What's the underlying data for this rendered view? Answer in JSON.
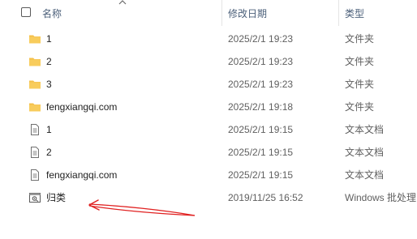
{
  "header": {
    "name_label": "名称",
    "date_label": "修改日期",
    "type_label": "类型"
  },
  "rows": [
    {
      "name": "1",
      "date": "2025/2/1 19:23",
      "type": "文件夹",
      "icon": "folder-icon"
    },
    {
      "name": "2",
      "date": "2025/2/1 19:23",
      "type": "文件夹",
      "icon": "folder-icon"
    },
    {
      "name": "3",
      "date": "2025/2/1 19:23",
      "type": "文件夹",
      "icon": "folder-icon"
    },
    {
      "name": "fengxiangqi.com",
      "date": "2025/2/1 19:18",
      "type": "文件夹",
      "icon": "folder-icon"
    },
    {
      "name": "1",
      "date": "2025/2/1 19:15",
      "type": "文本文档",
      "icon": "text-document-icon"
    },
    {
      "name": "2",
      "date": "2025/2/1 19:15",
      "type": "文本文档",
      "icon": "text-document-icon"
    },
    {
      "name": "fengxiangqi.com",
      "date": "2025/2/1 19:15",
      "type": "文本文档",
      "icon": "text-document-icon"
    },
    {
      "name": "归类",
      "date": "2019/11/25 16:52",
      "type": "Windows 批处理",
      "icon": "batch-file-icon"
    }
  ],
  "colors": {
    "folder": "#f4c04b",
    "arrow": "#e02020",
    "header_text": "#4c607a"
  }
}
